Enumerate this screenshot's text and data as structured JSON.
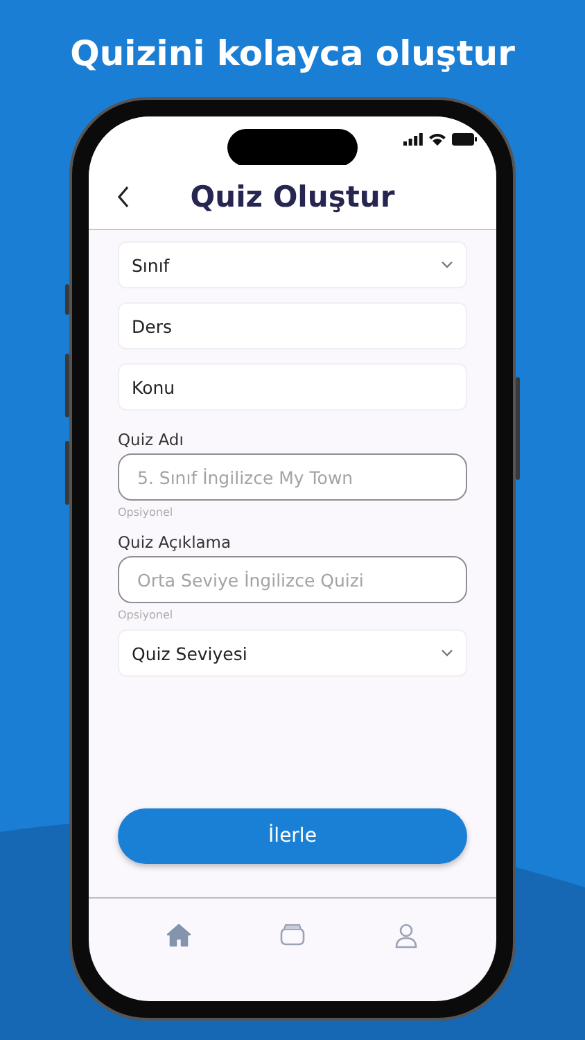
{
  "headline": "Quizini kolayca oluştur",
  "header": {
    "title": "Quiz Oluştur"
  },
  "fields": [
    {
      "kind": "select",
      "value": "Sınıf"
    },
    {
      "kind": "text",
      "value": "Ders"
    },
    {
      "kind": "text",
      "value": "Konu"
    },
    {
      "kind": "outlined",
      "label": "Quiz Adı",
      "placeholder": "5. Sınıf İngilizce My Town",
      "hint": "Opsiyonel"
    },
    {
      "kind": "outlined",
      "label": "Quiz Açıklama",
      "placeholder": "Orta Seviye İngilizce Quizi",
      "hint": "Opsiyonel"
    },
    {
      "kind": "select",
      "value": "Quiz Seviyesi"
    }
  ],
  "button": "İlerle",
  "nav": [
    {
      "kind": "home",
      "selected": true
    },
    {
      "kind": "box",
      "selected": false
    },
    {
      "kind": "person",
      "selected": false
    }
  ]
}
